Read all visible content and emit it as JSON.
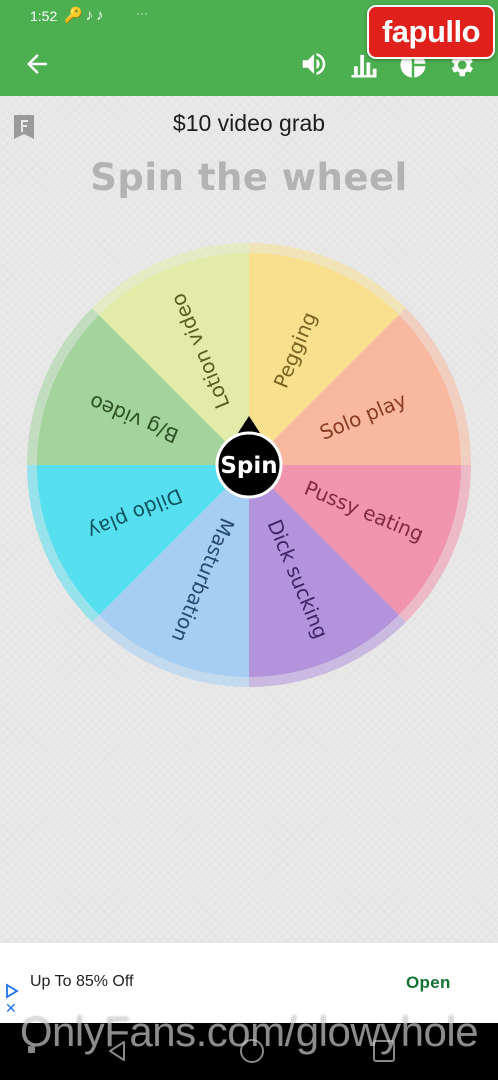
{
  "status_bar": {
    "time": "1:52",
    "icons": "🔑♪♪",
    "dots": "···"
  },
  "badge": {
    "text": "fapullo"
  },
  "app_bar": {
    "icons": [
      "arrow-left-icon",
      "volume-icon",
      "bar-chart-icon",
      "pie-chart-icon",
      "gear-icon"
    ]
  },
  "header": {
    "subtitle": "$10 video grab",
    "title": "Spin the wheel"
  },
  "wheel": {
    "center_label": "Spin",
    "segments": [
      {
        "label": "Pegging",
        "color": "#f8e08f",
        "text_color": "#7a6422"
      },
      {
        "label": "Solo play",
        "color": "#f8b9a0",
        "text_color": "#8a3b22"
      },
      {
        "label": "Pussy eating",
        "color": "#f095ad",
        "text_color": "#7e2a40"
      },
      {
        "label": "Dick sucking",
        "color": "#b393dc",
        "text_color": "#3e2566"
      },
      {
        "label": "Masturbation",
        "color": "#a6cdf2",
        "text_color": "#284a70"
      },
      {
        "label": "Dildo play",
        "color": "#55dfef",
        "text_color": "#0d5561"
      },
      {
        "label": "B/g video",
        "color": "#a2d49c",
        "text_color": "#2d5226"
      },
      {
        "label": "Lotion video",
        "color": "#e2eca8",
        "text_color": "#5a5d22"
      }
    ]
  },
  "ad": {
    "text": "Up To 85% Off",
    "action": "Open"
  },
  "watermark": {
    "text": "OnlyFans.com/glowyhole"
  }
}
